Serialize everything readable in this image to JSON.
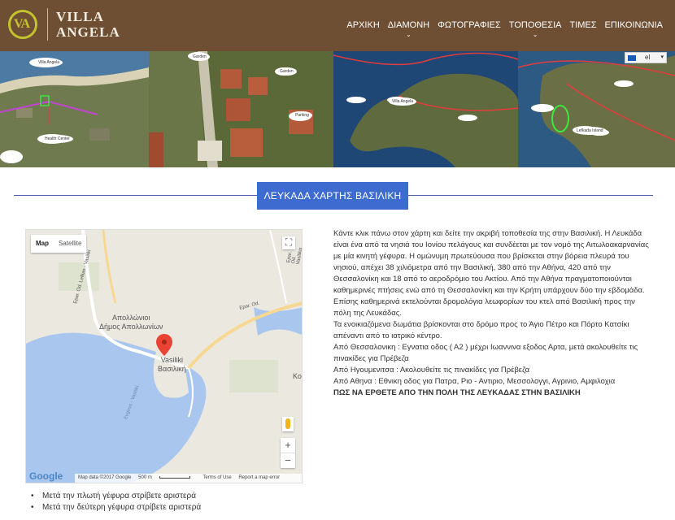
{
  "header": {
    "logo_mark": "VA",
    "logo_line1": "VILLA",
    "logo_line2": "ANGELA",
    "nav": [
      {
        "label": "ΑΡΧΙΚΗ",
        "has_dropdown": false
      },
      {
        "label": "ΔΙΑΜΟΝΗ",
        "has_dropdown": true
      },
      {
        "label": "ΦΩΤΟΓΡΑΦΙΕΣ",
        "has_dropdown": false
      },
      {
        "label": "ΤΟΠΟΘΕΣΙΑ",
        "has_dropdown": true
      },
      {
        "label": "ΤΙΜΕΣ",
        "has_dropdown": false
      },
      {
        "label": "ΕΠΙΚΟΙΝΩΝΙΑ",
        "has_dropdown": false
      }
    ],
    "brand_color": "#6e4f33",
    "logo_accent": "#c5c22f"
  },
  "language": {
    "code": "el",
    "arrow": "▾"
  },
  "banner": {
    "panel1_labels": [
      "Villa Angela",
      "Health Center"
    ],
    "panel2_labels": [
      "Garden",
      "Garden",
      "Parking"
    ],
    "panel3_labels": [
      "Villa Angela"
    ],
    "panel4_labels": [
      "Lefkada Island"
    ]
  },
  "section": {
    "title": "ΛΕΥΚΑΔΑ ΧΑΡΤΗΣ ΒΑΣΙΛΙΚΗ",
    "title_color": "#3e6bcf"
  },
  "map": {
    "type_map": "Map",
    "type_satellite": "Satellite",
    "place_name_1": "Απολλώνιοι",
    "place_name_2": "Δήμος Απολλωνίων",
    "town_latin": "Vasiliki",
    "town_greek": "Βασιλική",
    "road_1": "Epar. Od. Lefkas - Vasiliki",
    "road_2": "Epar. Od. Vasilikis",
    "road_3": "Epar. Od.",
    "side_label": "Κο",
    "sea_label": "Evgiros - Vasiliki",
    "zoom_in": "+",
    "zoom_out": "−",
    "fullscreen": "⛶",
    "google": "Google",
    "footer_data": "Map data ©2017 Google",
    "footer_scale": "500 m",
    "footer_terms": "Terms of Use",
    "footer_report": "Report a map error"
  },
  "description": {
    "p1": "Κάντε κλικ πάνω στον χάρτη και δείτε την ακριβή τοποθεσία της στην Βασιλική. Η Λευκάδα είναι ένα από τα νησιά του Ιονίου πελάγους και συνδέεται με τον νομό της Αιτωλοακαρνανίας με μία κινητή γέφυρα. Η ομώνυμη πρωτεύουσα που βρίσκεται στην βόρεια πλευρά του νησιού, απέχει 38 χιλιόμετρα από την Βασιλική, 380 από την Αθήνα, 420 από την Θεσσαλονίκη και 18 από το αεροδρόμιο του Ακτίου. Από την Αθήνα πραγματοποιούνται καθημερινές πτήσεις ενώ από τη Θεσσαλονίκη και την Κρήτη υπάρχουν δύο την εβδομάδα. Επίσης καθημερινά εκτελούνται δρομολόγια λεωφορίων του κτελ από Βασιλική προς την πόλη της Λευκάδας.",
    "p2": "Τα ενοικιαζόμενα δωμάτια βρίσκονται στο δρόμο προς το Άγιο Πέτρο και Πόρτο Κατσίκι απέναντι από το ιατρικό κέντρο.",
    "p3": "Από Θεσσαλονικη : Εγνατια οδος ( Α2 ) μέχρι Ιωαννινα εξοδος Αρτα, μετά ακολουθείτε τις πινακίδες για Πρέβεζα",
    "p4": "Από Ηγουμενιτσα : Ακολουθείτε τις πινακίδες για Πρέβεζα",
    "p5": "Από Αθηνα : Εθνικη οδος για Πατρα, Ριο - Αντιριο, Μεσσολογγι, Αγρινιο, Αμφιλοχια",
    "p6": "ΠΩΣ ΝΑ ΕΡΘΕΤΕ ΑΠΟ ΤΗΝ ΠΟΛΗ ΤΗΣ ΛΕΥΚΑΔΑΣ ΣΤΗΝ ΒΑΣΙΛΙΚΗ"
  },
  "directions": [
    "Μετά την πλωτή γέφυρα στρίβετε αριστερά",
    "Μετά την δεύτερη γέφυρα στρίβετε αριστερά"
  ]
}
